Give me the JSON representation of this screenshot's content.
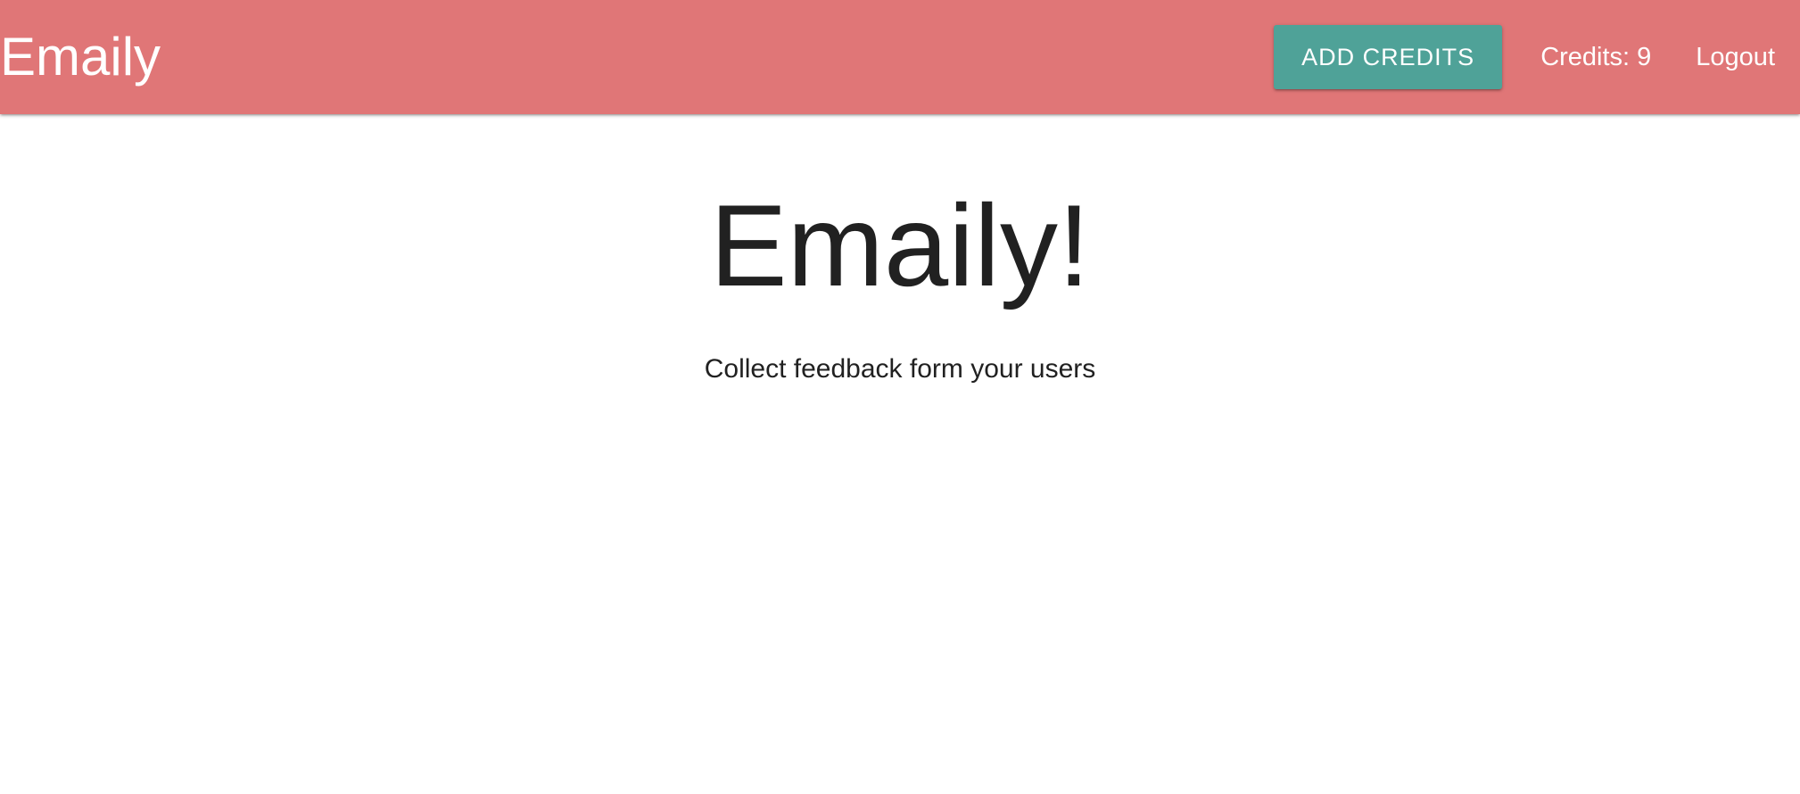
{
  "navbar": {
    "brand": "Emaily",
    "add_credits_label": "ADD CREDITS",
    "credits_text": "Credits: 9",
    "logout_label": "Logout"
  },
  "hero": {
    "title": "Emaily!",
    "subtitle": "Collect feedback form your users"
  },
  "colors": {
    "navbar_background": "#e07677",
    "button_background": "#4fa298",
    "text_dark": "#212121",
    "text_light": "#ffffff"
  }
}
